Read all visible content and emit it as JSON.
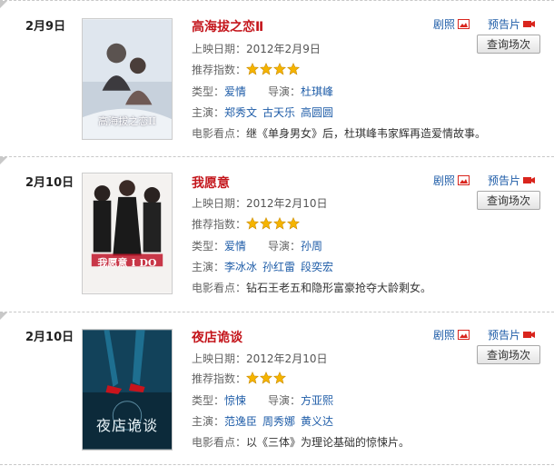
{
  "labels": {
    "release": "上映日期：",
    "rating": "推荐指数：",
    "type": "类型：",
    "director": "导演：",
    "cast": "主演：",
    "highlight": "电影看点：",
    "stills": "剧照",
    "trailer": "预告片",
    "query": "查询场次"
  },
  "colors": {
    "title": "#c4161c",
    "link": "#1f5da8",
    "star": "#f5b400",
    "icon": "#d9251d"
  },
  "movies": [
    {
      "date": "2月9日",
      "title": "高海拔之恋Ⅱ",
      "release": "2012年2月9日",
      "stars": 4,
      "type": "爱情",
      "director": "杜琪峰",
      "cast": [
        "郑秀文",
        "古天乐",
        "高圆圆"
      ],
      "highlight": "继《单身男女》后，杜琪峰韦家辉再造爱情故事。",
      "poster_text": "高海拔之恋II"
    },
    {
      "date": "2月10日",
      "title": "我愿意",
      "release": "2012年2月10日",
      "stars": 4,
      "type": "爱情",
      "director": "孙周",
      "cast": [
        "李冰冰",
        "孙红雷",
        "段奕宏"
      ],
      "highlight": "钻石王老五和隐形富豪抢夺大龄剩女。",
      "poster_text": "我愿意 I DO"
    },
    {
      "date": "2月10日",
      "title": "夜店诡谈",
      "release": "2012年2月10日",
      "stars": 3,
      "type": "惊悚",
      "director": "方亚熙",
      "cast": [
        "范逸臣",
        "周秀娜",
        "黄义达"
      ],
      "highlight": "以《三体》为理论基础的惊悚片。",
      "poster_text": "夜店诡谈"
    }
  ]
}
